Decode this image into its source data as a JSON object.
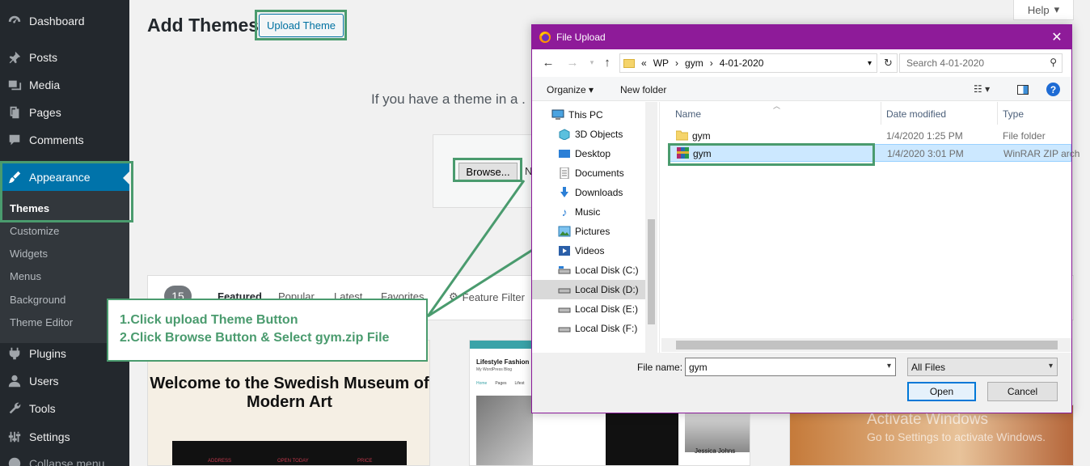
{
  "sidebar": {
    "items": [
      {
        "label": "Dashboard",
        "icon": "dashboard-icon"
      },
      {
        "label": "Posts",
        "icon": "pin-icon"
      },
      {
        "label": "Media",
        "icon": "media-icon"
      },
      {
        "label": "Pages",
        "icon": "pages-icon"
      },
      {
        "label": "Comments",
        "icon": "comment-icon"
      },
      {
        "label": "Appearance",
        "icon": "brush-icon"
      },
      {
        "label": "Plugins",
        "icon": "plugin-icon"
      },
      {
        "label": "Users",
        "icon": "user-icon"
      },
      {
        "label": "Tools",
        "icon": "wrench-icon"
      },
      {
        "label": "Settings",
        "icon": "settings-icon"
      },
      {
        "label": "Collapse menu",
        "icon": "collapse-icon"
      }
    ],
    "submenu": [
      "Themes",
      "Customize",
      "Widgets",
      "Menus",
      "Background",
      "Theme Editor"
    ]
  },
  "main": {
    "title": "Add Themes",
    "upload_button": "Upload Theme",
    "help": "Help",
    "upload_hint": "If you have a theme in a .",
    "browse_button": "Browse...",
    "browse_trailing": "N",
    "theme_count": "15",
    "filters": [
      "Featured",
      "Popular",
      "Latest",
      "Favorites"
    ],
    "feature_filter": "Feature Filter"
  },
  "themes": {
    "card1_title": "Welcome to the Swedish Museum of Modern Art",
    "card1_labels": [
      "ADDRESS",
      "OPEN TODAY",
      "PRICE"
    ],
    "card2_title": "Lifestyle Fashion",
    "card2_sub": "My WordPress Blog",
    "card2_nav": [
      "Home",
      "Pages",
      "Lifest"
    ],
    "card2_author": "Jessica Johns"
  },
  "watermark": {
    "title": "Activate Windows",
    "sub": "Go to Settings to activate Windows."
  },
  "annotation": {
    "line1": "1.Click upload Theme Button",
    "line2": "2.Click Browse Button  & Select gym.zip File"
  },
  "dialog": {
    "title": "File Upload",
    "path": [
      "«",
      "WP",
      "›",
      "gym",
      "›",
      "4-01-2020"
    ],
    "search_placeholder": "Search 4-01-2020",
    "organize": "Organize",
    "new_folder": "New folder",
    "nav": [
      {
        "label": "This PC",
        "icon": "computer-icon"
      },
      {
        "label": "3D Objects",
        "icon": "cube-icon"
      },
      {
        "label": "Desktop",
        "icon": "desktop-icon"
      },
      {
        "label": "Documents",
        "icon": "document-icon"
      },
      {
        "label": "Downloads",
        "icon": "download-icon"
      },
      {
        "label": "Music",
        "icon": "music-icon"
      },
      {
        "label": "Pictures",
        "icon": "picture-icon"
      },
      {
        "label": "Videos",
        "icon": "video-icon"
      },
      {
        "label": "Local Disk (C:)",
        "icon": "disk-icon"
      },
      {
        "label": "Local Disk (D:)",
        "icon": "disk-icon"
      },
      {
        "label": "Local Disk (E:)",
        "icon": "disk-icon"
      },
      {
        "label": "Local Disk (F:)",
        "icon": "disk-icon"
      }
    ],
    "columns": [
      "Name",
      "Date modified",
      "Type"
    ],
    "files": [
      {
        "name": "gym",
        "date": "1/4/2020 1:25 PM",
        "type": "File folder",
        "icon": "folder-icon"
      },
      {
        "name": "gym",
        "date": "1/4/2020 3:01 PM",
        "type": "WinRAR ZIP arch",
        "icon": "zip-icon"
      }
    ],
    "file_name_label": "File name:",
    "file_name_value": "gym",
    "file_type": "All Files",
    "open": "Open",
    "cancel": "Cancel"
  },
  "colors": {
    "highlight": "#4a9b6e",
    "wp_sidebar": "#23282d",
    "wp_active": "#0073aa",
    "dialog_title": "#8e1b99"
  }
}
